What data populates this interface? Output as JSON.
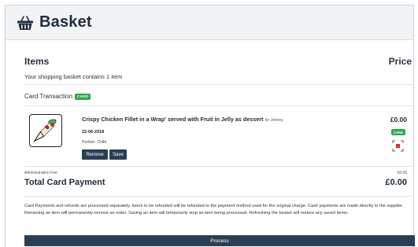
{
  "header": {
    "title": "Basket",
    "icon": "basket-icon"
  },
  "items_section": {
    "items_title": "Items",
    "price_title": "Price",
    "basket_count_text": "Your shopping basket contains 1 item"
  },
  "card_transaction": {
    "label": "Card Transaction",
    "badge": "CARD"
  },
  "item": {
    "title": "Crispy Chicken Fillet in a Wrap' served with Fruit in Jelly as dessert",
    "for_text": "for Johnny",
    "date": "22-06-2018",
    "portion": "Portion: Child",
    "remove_label": "Remove",
    "save_label": "Save",
    "price": "£0.00",
    "badge": "CARD"
  },
  "admin_fee": {
    "label": "Administration Fee",
    "value": "£0.00"
  },
  "total": {
    "label": "Total Card Payment",
    "value": "£0.00"
  },
  "notice": "Card Payments and refunds are processed separately. Items to be refunded will be refunded to the payment method used for the original charge. Cash payments are made directly to the supplier. Removing an item will permanently remove an order. Saving an item will temporarily stop an item being processed. Refreshing the basket will restore any saved items.",
  "process_label": "Process",
  "colors": {
    "primary_button": "#2c3e55",
    "card_badge": "#2fa84f",
    "qr_accent": "#e0263b"
  }
}
